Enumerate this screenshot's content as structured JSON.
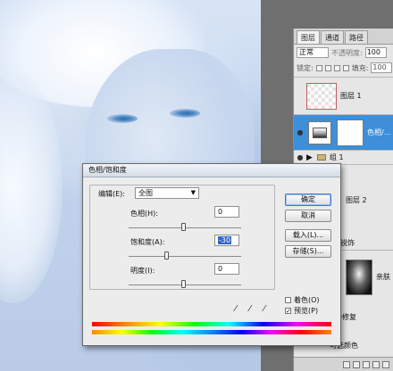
{
  "layers_panel": {
    "tabs": [
      "图层",
      "通道",
      "路径"
    ],
    "blend_mode": "正常",
    "opacity_label": "不透明度:",
    "opacity_value": "100",
    "lock_label": "锁定:",
    "fill_label": "填充:",
    "fill_value": "100",
    "layers": [
      {
        "name": "图层 1"
      },
      {
        "name": "色相/..."
      },
      {
        "name": "组 1"
      },
      {
        "name": "图层 2"
      },
      {
        "name": "亲肤"
      }
    ],
    "partial_labels": [
      "锐饰",
      "静修复",
      "可选颜色"
    ]
  },
  "dialog": {
    "title": "色相/饱和度",
    "edit_label": "编辑(E):",
    "edit_value": "全图",
    "hue_label": "色相(H):",
    "hue_value": "0",
    "saturation_label": "饱和度(A):",
    "saturation_value": "-30",
    "lightness_label": "明度(I):",
    "lightness_value": "0",
    "buttons": {
      "ok": "确定",
      "cancel": "取消",
      "load": "载入(L)...",
      "save": "存储(S)..."
    },
    "colorize_label": "着色(O)",
    "preview_label": "预览(P)",
    "colorize_checked": false,
    "preview_checked": true,
    "check_glyph": "✓"
  }
}
